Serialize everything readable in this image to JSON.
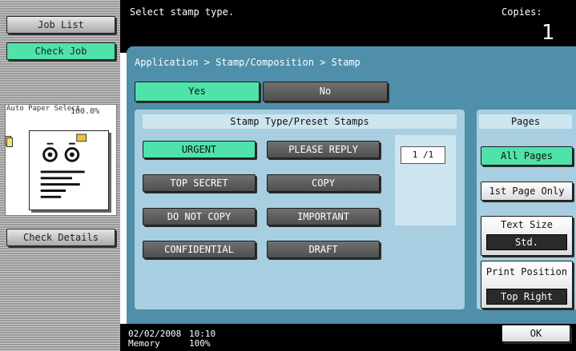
{
  "sidebar": {
    "job_list": "Job List",
    "check_job": "Check Job",
    "auto_paper": "Auto Paper Select",
    "zoom_ratio": "100.0%",
    "check_details": "Check Details"
  },
  "header": {
    "message": "Select stamp type.",
    "copies_label": "Copies:",
    "copies_value": "1"
  },
  "breadcrumb": "Application > Stamp/Composition > Stamp",
  "toggle": {
    "yes": "Yes",
    "no": "No",
    "selected": "Yes"
  },
  "stamp_types": {
    "header": "Stamp Type/Preset Stamps",
    "items": [
      "URGENT",
      "PLEASE REPLY",
      "TOP SECRET",
      "COPY",
      "DO NOT COPY",
      "IMPORTANT",
      "CONFIDENTIAL",
      "DRAFT"
    ],
    "selected": "URGENT",
    "page_indicator": "1  /1"
  },
  "pages": {
    "header": "Pages",
    "all_pages": "All Pages",
    "first_page_only": "1st Page Only",
    "selected": "All Pages"
  },
  "text_size": {
    "label": "Text Size",
    "value": "Std."
  },
  "print_position": {
    "label": "Print Position",
    "value": "Top Right"
  },
  "ok": "OK",
  "status": {
    "date": "02/02/2008",
    "time": "10:10",
    "memory_label": "Memory",
    "memory_value": "100%"
  },
  "colors": {
    "accent_green": "#4fe3a9",
    "panel_blue": "#4f8fa9",
    "subpanel_blue": "#a8cfe1"
  }
}
